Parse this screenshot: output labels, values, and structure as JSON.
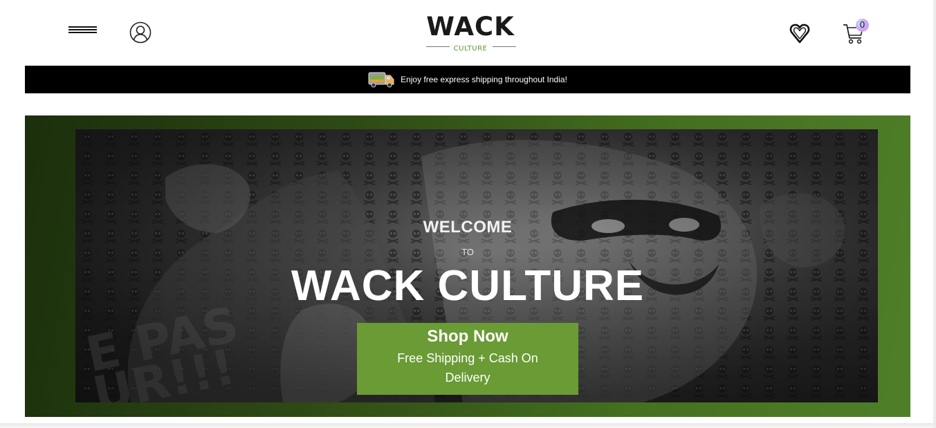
{
  "header": {
    "menu_icon": "hamburger-icon",
    "account_icon": "user-icon",
    "logo": {
      "main": "WACK",
      "sub": "CULTURE"
    },
    "wishlist_icon": "heart-icon",
    "cart_icon": "cart-icon",
    "cart_count": "0"
  },
  "promo_bar": {
    "icon": "truck-icon",
    "text": "Enjoy free express shipping throughout India!"
  },
  "hero": {
    "welcome": "WELCOME",
    "to": "TO",
    "brand": "WACK CULTURE",
    "cta": {
      "title": "Shop Now",
      "subtitle": "Free Shipping + Cash On Delivery"
    }
  },
  "colors": {
    "accent_green": "#6a9b35",
    "promo_bg": "#000000",
    "logo_green": "#5a9a2a"
  }
}
